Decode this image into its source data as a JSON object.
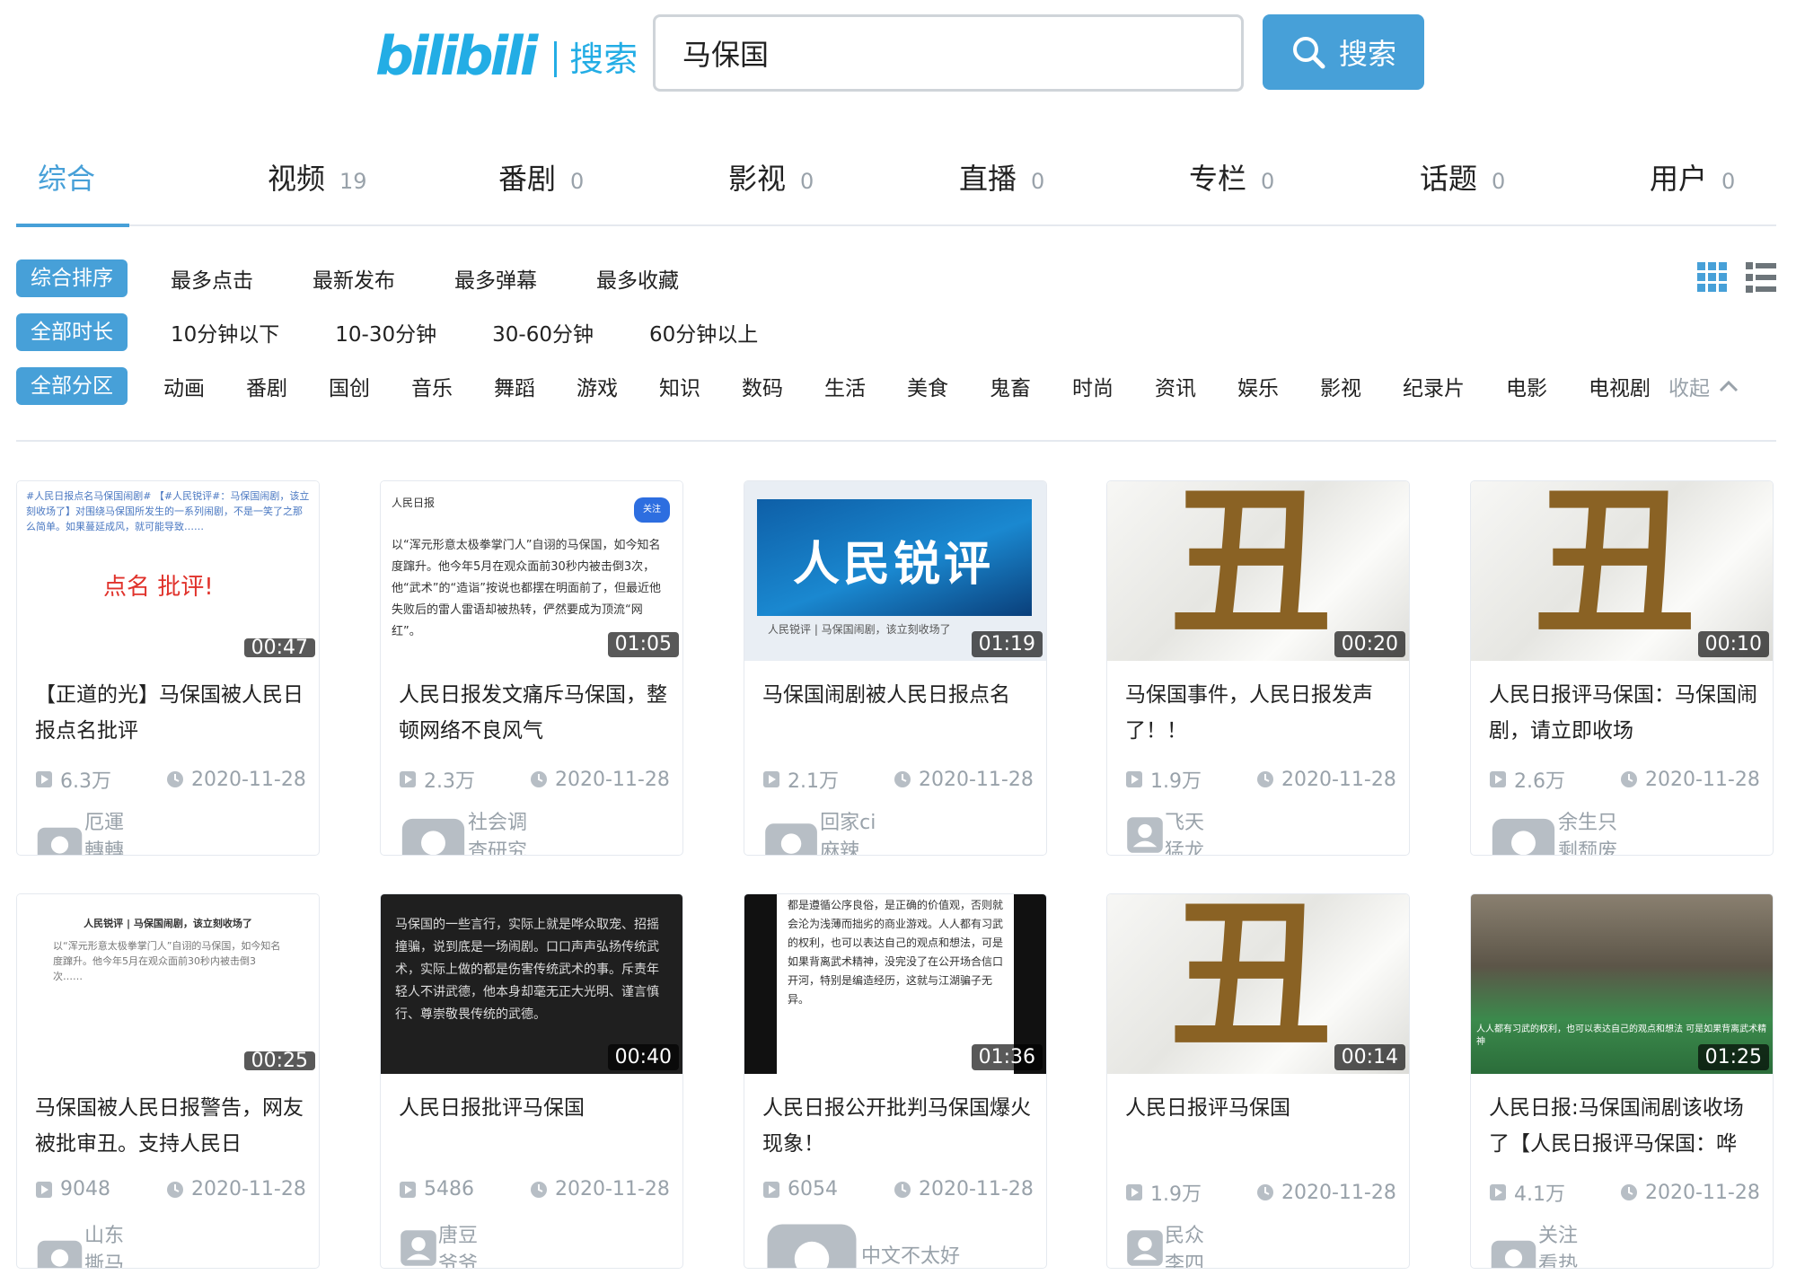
{
  "header": {
    "logo_text": "bilibili",
    "logo_sub": "搜索",
    "search_value": "马保国",
    "search_button": "搜索"
  },
  "tabs": [
    {
      "label": "综合",
      "count": ""
    },
    {
      "label": "视频",
      "count": "19"
    },
    {
      "label": "番剧",
      "count": "0"
    },
    {
      "label": "影视",
      "count": "0"
    },
    {
      "label": "直播",
      "count": "0"
    },
    {
      "label": "专栏",
      "count": "0"
    },
    {
      "label": "话题",
      "count": "0"
    },
    {
      "label": "用户",
      "count": "0"
    }
  ],
  "sort": {
    "active": "综合排序",
    "options": [
      "最多点击",
      "最新发布",
      "最多弹幕",
      "最多收藏"
    ]
  },
  "duration": {
    "active": "全部时长",
    "options": [
      "10分钟以下",
      "10-30分钟",
      "30-60分钟",
      "60分钟以上"
    ]
  },
  "zones": {
    "active": "全部分区",
    "options": [
      "动画",
      "番剧",
      "国创",
      "音乐",
      "舞蹈",
      "游戏",
      "知识",
      "数码",
      "生活",
      "美食",
      "鬼畜",
      "时尚",
      "资讯",
      "娱乐",
      "影视",
      "纪录片",
      "电影",
      "电视剧"
    ],
    "collapse": "收起"
  },
  "videos": [
    {
      "title": "【正道的光】马保国被人民日报点名批评",
      "duration": "00:47",
      "views": "6.3万",
      "date": "2020-11-28",
      "author": "厄運轉轉神",
      "thumb_text": "点名 批评!"
    },
    {
      "title": "人民日报发文痛斥马保国，整顿网络不良风气",
      "duration": "01:05",
      "views": "2.3万",
      "date": "2020-11-28",
      "author": "社会调查研究员",
      "thumb_text": "以“浑元形意太极拳掌门人”自诩的马保国，如今知名度蹿升。他今年5月在观众面前30秒内被击倒3次，他“武术”的“造诣”按说也都摆在明面前了，但最近他失败后的雷人雷语却被热转，俨然要成为顶流“网红”。"
    },
    {
      "title": "马保国闹剧被人民日报点名",
      "duration": "01:19",
      "views": "2.1万",
      "date": "2020-11-28",
      "author": "回家ci麻辣拌",
      "thumb_text": "人民锐评"
    },
    {
      "title": "马保国事件，人民日报发声了！！",
      "duration": "00:20",
      "views": "1.9万",
      "date": "2020-11-28",
      "author": "飞天猛龙",
      "thumb_text": "丑"
    },
    {
      "title": "人民日报评马保国：马保国闹剧，请立即收场",
      "duration": "00:10",
      "views": "2.6万",
      "date": "2020-11-28",
      "author": "余生只剩颓废了",
      "thumb_text": "丑"
    },
    {
      "title": "马保国被人民日报警告，网友被批审丑。支持人民日",
      "duration": "00:25",
      "views": "9048",
      "date": "2020-11-28",
      "author": "山东撕马男",
      "thumb_text": "人民锐评 | 马保国闹剧，该立刻收场了"
    },
    {
      "title": "人民日报批评马保国",
      "duration": "00:40",
      "views": "5486",
      "date": "2020-11-28",
      "author": "唐豆爷爷",
      "thumb_text": "马保国的一些言行，实际上就是哗众取宠、招摇撞骗，说到底是一场闹剧。口口声声弘扬传统武术，实际上做的都是伤害传统武术的事。斥责年轻人不讲武德，他本身却毫无正大光明、谨言慎行、尊崇敬畏传统的武德。"
    },
    {
      "title": "人民日报公开批判马保国爆火现象！",
      "duration": "01:36",
      "views": "6054",
      "date": "2020-11-28",
      "author": "中文不太好的潘婷骑士",
      "thumb_text": "都是遵循公序良俗，是正确的价值观，否则就会沦为浅薄而拙劣的商业游戏。人人都有习武的权利，也可以表达自己的观点和想法，可是如果背离武术精神，没完没了在公开场合信口开河，特别是编造经历，这就与江湖骗子无异。"
    },
    {
      "title": "人民日报评马保国",
      "duration": "00:14",
      "views": "1.9万",
      "date": "2020-11-28",
      "author": "民众李四",
      "thumb_text": "丑"
    },
    {
      "title": "人民日报:马保国闹剧该收场了【人民日报评马保国：哗",
      "duration": "01:25",
      "views": "4.1万",
      "date": "2020-11-28",
      "author": "关注看热点",
      "thumb_text": "人人都有习武的权利，也可以表达自己的观点和想法 可是如果背离武术精神"
    }
  ],
  "colors": {
    "accent": "#47a0d8",
    "brand": "#23ade5",
    "muted": "#99a2aa"
  }
}
